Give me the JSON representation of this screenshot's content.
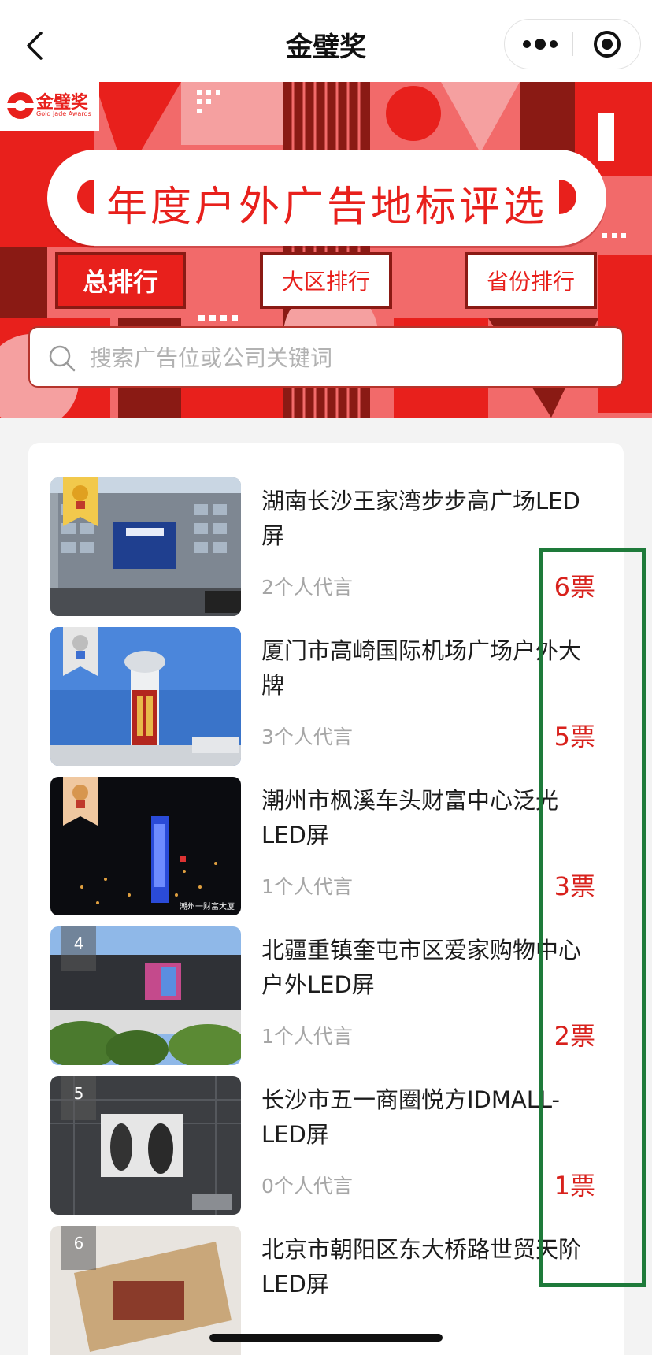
{
  "nav": {
    "title": "金璧奖",
    "back_icon": "chevron-left-icon",
    "more_icon": "more-dots-icon",
    "close_icon": "close-circle-icon"
  },
  "hero": {
    "logo_text": "金璧奖",
    "logo_subtext": "Gold Jade Awards",
    "title": "年度户外广告地标评选",
    "colors": {
      "primary": "#e8201c",
      "dark": "#8a1a14",
      "pink": "#f5a0a0"
    }
  },
  "tabs": [
    {
      "label": "总排行",
      "active": true
    },
    {
      "label": "大区排行",
      "active": false
    },
    {
      "label": "省份排行",
      "active": false
    }
  ],
  "search": {
    "placeholder": "搜索广告位或公司关键词"
  },
  "items": [
    {
      "rank": "1",
      "title": "湖南长沙王家湾步步高广场LED屏",
      "sub": "2个人代言",
      "votes": "6票",
      "medal": "gold"
    },
    {
      "rank": "2",
      "title": "厦门市高崎国际机场广场户外大牌",
      "sub": "3个人代言",
      "votes": "5票",
      "medal": "silver"
    },
    {
      "rank": "3",
      "title": "潮州市枫溪车头财富中心泛光LED屏",
      "sub": "1个人代言",
      "votes": "3票",
      "medal": "bronze"
    },
    {
      "rank": "4",
      "title": "北疆重镇奎屯市区爱家购物中心户外LED屏",
      "sub": "1个人代言",
      "votes": "2票"
    },
    {
      "rank": "5",
      "title": "长沙市五一商圈悦方IDMALL-LED屏",
      "sub": "0个人代言",
      "votes": "1票"
    },
    {
      "rank": "6",
      "title": "北京市朝阳区东大桥路世贸天阶LED屏",
      "sub": "",
      "votes": ""
    }
  ],
  "thumb_texts": {
    "item3_caption": "潮州一财富大厦"
  },
  "annotation_color": "#1e7a3a"
}
